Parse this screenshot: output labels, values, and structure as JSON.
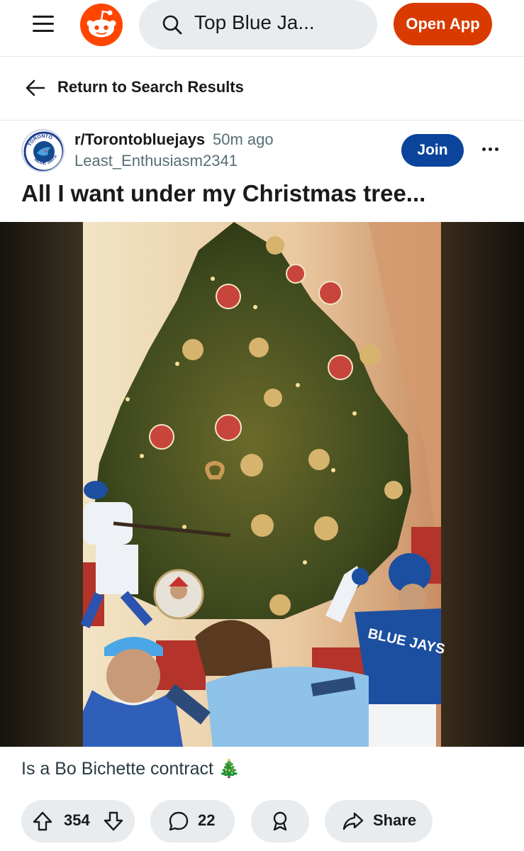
{
  "header": {
    "search_text": "Top Blue Ja...",
    "open_app_label": "Open App"
  },
  "nav": {
    "return_label": "Return to Search Results"
  },
  "post": {
    "subreddit": "r/Torontobluejays",
    "time_ago": "50m ago",
    "author": "Least_Enthusiasm2341",
    "join_label": "Join",
    "title": "All I want under my Christmas tree...",
    "body": "Is a Bo Bichette contract 🎄",
    "subreddit_logo_text_top": "TORONTO",
    "subreddit_logo_text_bottom": "BLUE JAYS",
    "jersey_text": "BLUE JAYS"
  },
  "actions": {
    "upvotes": "354",
    "comments": "22",
    "share_label": "Share"
  },
  "colors": {
    "brand_orange": "#ff4500",
    "open_app_bg": "#d93a00",
    "join_bg": "#0a449b",
    "pill_bg": "#e9ecee"
  },
  "icons": [
    "menu-icon",
    "reddit-logo-icon",
    "search-icon",
    "back-arrow-icon",
    "more-icon",
    "upvote-icon",
    "downvote-icon",
    "comment-icon",
    "award-icon",
    "share-icon"
  ]
}
